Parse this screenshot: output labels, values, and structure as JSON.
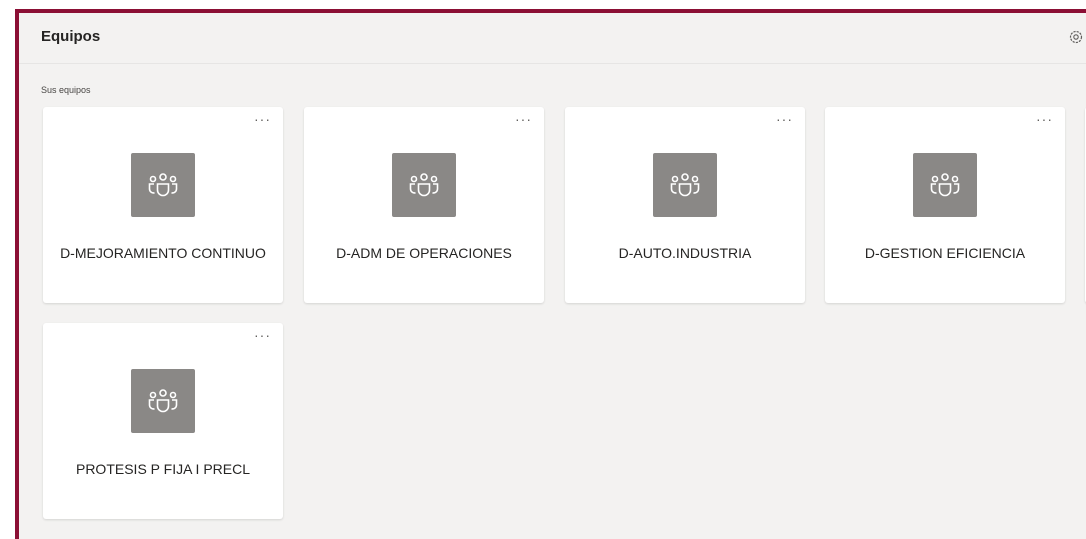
{
  "header": {
    "title": "Equipos",
    "settings_icon": "gear-icon"
  },
  "section": {
    "label": "Sus equipos"
  },
  "teams": [
    {
      "name": "D-MEJORAMIENTO CONTINUO",
      "more_label": "···",
      "icon": "teams-people-icon"
    },
    {
      "name": "D-ADM DE OPERACIONES",
      "more_label": "···",
      "icon": "teams-people-icon"
    },
    {
      "name": "D-AUTO.INDUSTRIA",
      "more_label": "···",
      "icon": "teams-people-icon"
    },
    {
      "name": "D-GESTION EFICIENCIA",
      "more_label": "···",
      "icon": "teams-people-icon"
    },
    {
      "name": "PROTESIS P FIJA I PRECL",
      "more_label": "···",
      "icon": "teams-people-icon"
    }
  ],
  "colors": {
    "accent_border": "#8b0f35",
    "tile": "#8a8886",
    "background": "#f3f2f1"
  }
}
